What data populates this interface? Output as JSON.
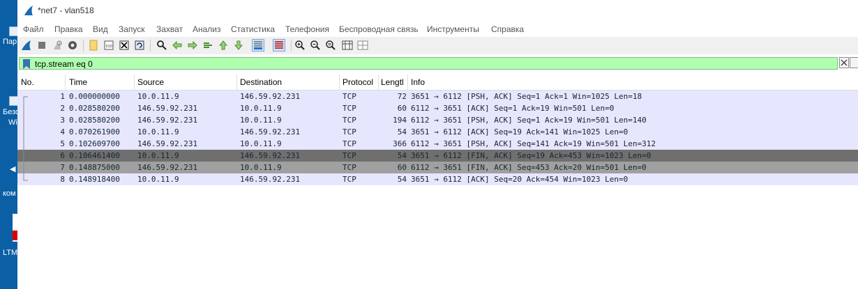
{
  "desktop": {
    "labels": [
      "Пар",
      "Безо",
      "Wi",
      "ком",
      "LTM"
    ]
  },
  "window": {
    "title": "*net7 - vlan518"
  },
  "menubar": {
    "items": [
      "Файл",
      "Правка",
      "Вид",
      "Запуск",
      "Захват",
      "Анализ",
      "Статистика",
      "Телефония",
      "Беспроводная связь",
      "Инструменты",
      "Справка"
    ]
  },
  "toolbar": {
    "buttons": [
      "start-capture-icon",
      "stop-capture-icon",
      "restart-capture-icon",
      "capture-options-icon",
      "open-file-icon",
      "save-file-icon",
      "close-file-icon",
      "reload-icon",
      "find-packet-icon",
      "go-back-icon",
      "go-forward-icon",
      "go-to-packet-icon",
      "go-first-icon",
      "go-last-icon",
      "auto-scroll-icon",
      "colorize-icon",
      "zoom-in-icon",
      "zoom-out-icon",
      "normal-size-icon",
      "resize-columns-icon",
      "layout-icon"
    ]
  },
  "filter": {
    "value": "tcp.stream eq 0",
    "color": "#afffaf"
  },
  "columns": {
    "no": "No.",
    "time": "Time",
    "source": "Source",
    "destination": "Destination",
    "protocol": "Protocol",
    "length": "Lengtl",
    "info": "Info"
  },
  "packets": [
    {
      "no": "1",
      "time": "0.000000000",
      "source": "10.0.11.9",
      "destination": "146.59.92.231",
      "protocol": "TCP",
      "length": "72",
      "info": "3651 → 6112 [PSH, ACK] Seq=1 Ack=1 Win=1025 Len=18",
      "style": "light"
    },
    {
      "no": "2",
      "time": "0.028580200",
      "source": "146.59.92.231",
      "destination": "10.0.11.9",
      "protocol": "TCP",
      "length": "60",
      "info": "6112 → 3651 [ACK] Seq=1 Ack=19 Win=501 Len=0",
      "style": "light"
    },
    {
      "no": "3",
      "time": "0.028580200",
      "source": "146.59.92.231",
      "destination": "10.0.11.9",
      "protocol": "TCP",
      "length": "194",
      "info": "6112 → 3651 [PSH, ACK] Seq=1 Ack=19 Win=501 Len=140",
      "style": "light"
    },
    {
      "no": "4",
      "time": "0.070261900",
      "source": "10.0.11.9",
      "destination": "146.59.92.231",
      "protocol": "TCP",
      "length": "54",
      "info": "3651 → 6112 [ACK] Seq=19 Ack=141 Win=1025 Len=0",
      "style": "light"
    },
    {
      "no": "5",
      "time": "0.102609700",
      "source": "146.59.92.231",
      "destination": "10.0.11.9",
      "protocol": "TCP",
      "length": "366",
      "info": "6112 → 3651 [PSH, ACK] Seq=141 Ack=19 Win=501 Len=312",
      "style": "light"
    },
    {
      "no": "6",
      "time": "0.106461400",
      "source": "10.0.11.9",
      "destination": "146.59.92.231",
      "protocol": "TCP",
      "length": "54",
      "info": "3651 → 6112 [FIN, ACK] Seq=19 Ack=453 Win=1023 Len=0",
      "style": "dark"
    },
    {
      "no": "7",
      "time": "0.148875000",
      "source": "146.59.92.231",
      "destination": "10.0.11.9",
      "protocol": "TCP",
      "length": "60",
      "info": "6112 → 3651 [FIN, ACK] Seq=453 Ack=20 Win=501 Len=0",
      "style": "gray"
    },
    {
      "no": "8",
      "time": "0.148918400",
      "source": "10.0.11.9",
      "destination": "146.59.92.231",
      "protocol": "TCP",
      "length": "54",
      "info": "3651 → 6112 [ACK] Seq=20 Ack=454 Win=1023 Len=0",
      "style": "light"
    }
  ]
}
